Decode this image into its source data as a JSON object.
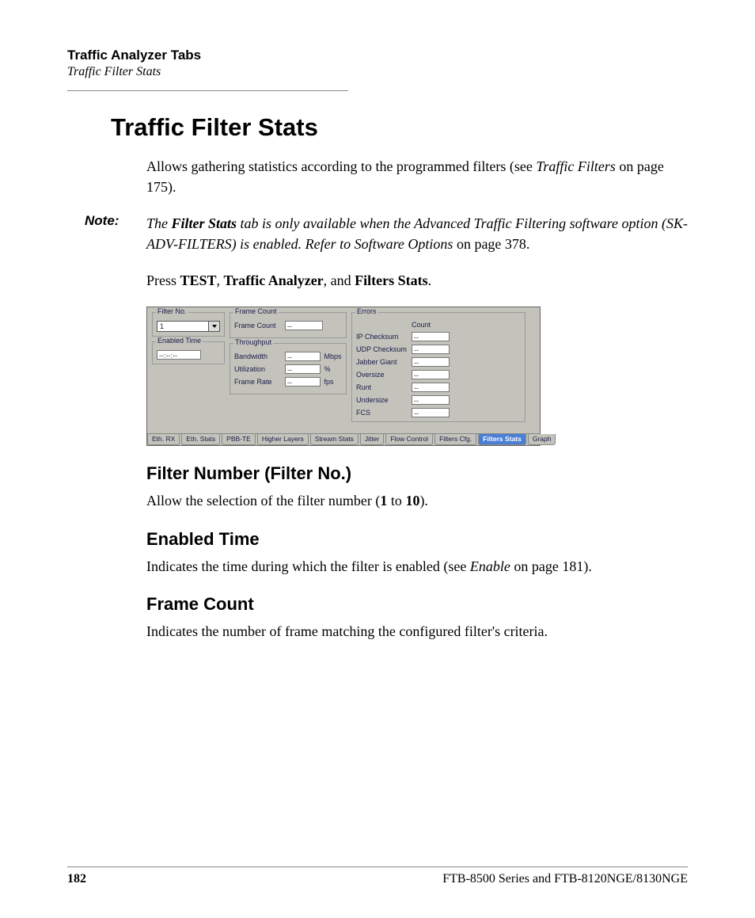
{
  "header": {
    "title": "Traffic Analyzer Tabs",
    "subtitle": "Traffic Filter Stats"
  },
  "h1": "Traffic Filter Stats",
  "intro": {
    "p1a": "Allows gathering statistics according to the programmed filters (see ",
    "p1b": "Traffic Filters",
    "p1c": " on page 175)."
  },
  "note": {
    "label": "Note:",
    "t1": "The ",
    "t2": "Filter Stats",
    "t3": " tab is only available when the Advanced Traffic Filtering software option (SK-ADV-FILTERS) is enabled. Refer to Software Options",
    "t4": " on page 378."
  },
  "press": {
    "a": "Press ",
    "b": "TEST",
    "c": ", ",
    "d": "Traffic Analyzer",
    "e": ", and ",
    "f": "Filters Stats",
    "g": "."
  },
  "ui": {
    "filterNo": {
      "title": "Filter No.",
      "value": "1"
    },
    "enabledTime": {
      "title": "Enabled Time",
      "value": "--:--:--"
    },
    "frameCount": {
      "title": "Frame Count",
      "label": "Frame Count",
      "value": "--"
    },
    "throughput": {
      "title": "Throughput",
      "rows": [
        {
          "label": "Bandwidth",
          "value": "--",
          "unit": "Mbps"
        },
        {
          "label": "Utilization",
          "value": "--",
          "unit": "%"
        },
        {
          "label": "Frame Rate",
          "value": "--",
          "unit": "fps"
        }
      ]
    },
    "errors": {
      "title": "Errors",
      "countHeader": "Count",
      "rows": [
        {
          "label": "IP Checksum",
          "value": "--"
        },
        {
          "label": "UDP Checksum",
          "value": "--"
        },
        {
          "label": "Jabber Giant",
          "value": "--"
        },
        {
          "label": "Oversize",
          "value": "--"
        },
        {
          "label": "Runt",
          "value": "--"
        },
        {
          "label": "Undersize",
          "value": "--"
        },
        {
          "label": "FCS",
          "value": "--"
        }
      ]
    },
    "tabs": [
      "Eth. RX",
      "Eth. Stats",
      "PBB-TE",
      "Higher Layers",
      "Stream Stats",
      "Jitter",
      "Flow Control",
      "Filters Cfg.",
      "Filters Stats",
      "Graph"
    ],
    "activeTab": "Filters Stats"
  },
  "sections": {
    "filterNumber": {
      "h": "Filter Number (Filter No.)",
      "p_a": "Allow the selection of the filter number (",
      "p_b": "1",
      "p_c": " to ",
      "p_d": "10",
      "p_e": ")."
    },
    "enabledTime": {
      "h": "Enabled Time",
      "p_a": "Indicates the time during which the filter is enabled (see ",
      "p_b": "Enable",
      "p_c": " on page 181)."
    },
    "frameCount": {
      "h": "Frame Count",
      "p": "Indicates the number of frame matching the configured filter's criteria."
    }
  },
  "footer": {
    "page": "182",
    "product": "FTB-8500 Series and FTB-8120NGE/8130NGE"
  }
}
